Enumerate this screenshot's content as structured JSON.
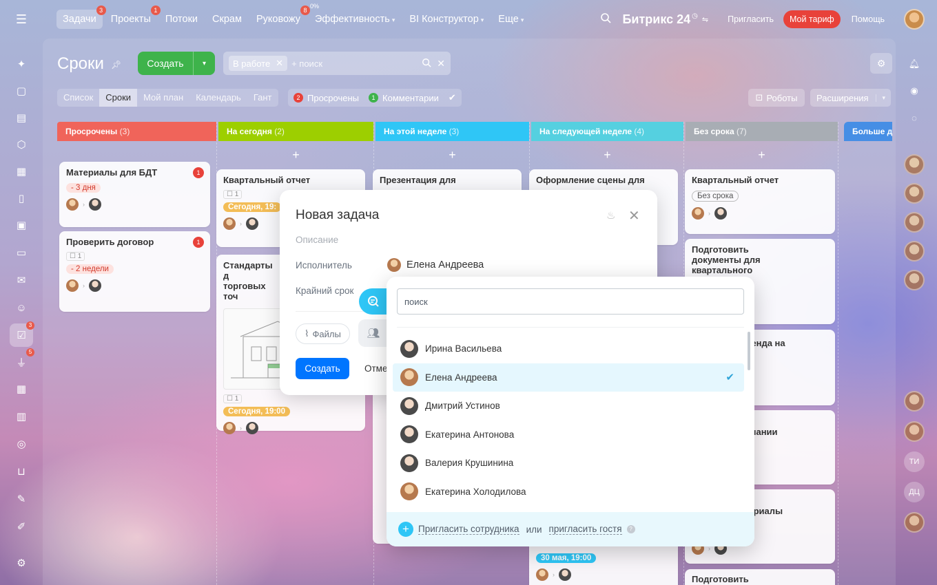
{
  "nav": {
    "items": [
      {
        "label": "Задачи",
        "badge": "3",
        "active": true
      },
      {
        "label": "Проекты",
        "badge": "1"
      },
      {
        "label": "Потоки"
      },
      {
        "label": "Скрам"
      },
      {
        "label": "Руковожу",
        "badge": "8"
      },
      {
        "label": "Эффективность",
        "pct": "0%",
        "dropdown": true
      },
      {
        "label": "BI Конструктор",
        "dropdown": true
      },
      {
        "label": "Еще",
        "dropdown": true
      }
    ],
    "logo": "Битрикс 24",
    "invite": "Пригласить",
    "tariff": "Мой тариф",
    "help": "Помощь"
  },
  "sidebar": {
    "task_badge": "3",
    "feed_badge": "5"
  },
  "toolbar": {
    "title": "Сроки",
    "create_label": "Создать",
    "filter_chip": "В работе",
    "search_placeholder": "+ поиск"
  },
  "views": [
    "Список",
    "Сроки",
    "Мой план",
    "Календарь",
    "Гант"
  ],
  "counters": {
    "overdue_count": "2",
    "overdue_label": "Просрочены",
    "comments_count": "1",
    "comments_label": "Комментарии"
  },
  "robots_label": "Роботы",
  "extensions_label": "Расширения",
  "columns": [
    {
      "title": "Просрочены",
      "count": "(3)",
      "color": "#f0645a"
    },
    {
      "title": "На сегодня",
      "count": "(2)",
      "color": "#9dcf00"
    },
    {
      "title": "На этой неделе",
      "count": "(3)",
      "color": "#2fc6f6"
    },
    {
      "title": "На следующей неделе",
      "count": "(4)",
      "color": "#55d0e0"
    },
    {
      "title": "Без срока",
      "count": "(7)",
      "color": "#a8adb4"
    },
    {
      "title": "Больше д",
      "count": "",
      "color": "#468ee5"
    }
  ],
  "cards": {
    "c1": {
      "title": "Материалы для БДТ",
      "badge": "1",
      "tag": "- 3 дня"
    },
    "c2": {
      "title": "Проверить договор",
      "badge": "1",
      "check": "1",
      "tag": "- 2 недели"
    },
    "c3": {
      "title": "Квартальный отчет",
      "check": "1",
      "tag": "Сегодня, 19:"
    },
    "c4": {
      "title": "Стандарты д торговых точ",
      "check": "1",
      "tag": "Сегодня, 19:00"
    },
    "c5": {
      "title": "Презентация для"
    },
    "c6": {
      "title": "Оформление сцены для"
    },
    "c7": {
      "title": "Квартальный отчет",
      "tag": "Без срока"
    },
    "c8": {
      "title": "Подготовить документы для квартального отчета"
    },
    "c9": {
      "title": "тенда на"
    },
    "c10": {
      "title": "мпании"
    },
    "c11": {
      "title": "териалы"
    },
    "c12": {
      "title": "Подготовить"
    },
    "c13": {
      "tag": "30 мая, 19:00"
    }
  },
  "modal": {
    "title": "Новая задача",
    "description_placeholder": "Описание",
    "assignee_label": "Исполнитель",
    "assignee_name": "Елена Андреева",
    "deadline_label": "Крайний срок",
    "files_label": "Файлы",
    "create_label": "Создать",
    "cancel_label": "Отме"
  },
  "dropdown": {
    "search_placeholder": "поиск",
    "people": [
      {
        "name": "Ирина Васильева",
        "selected": false
      },
      {
        "name": "Елена Андреева",
        "selected": true
      },
      {
        "name": "Дмитрий Устинов",
        "selected": false
      },
      {
        "name": "Екатерина Антонова",
        "selected": false
      },
      {
        "name": "Валерия Крушинина",
        "selected": false
      },
      {
        "name": "Екатерина Холодилова",
        "selected": false
      }
    ],
    "invite_employee": "Пригласить сотрудника",
    "or": "или",
    "invite_guest": "пригласить гостя"
  },
  "right_sidebar": {
    "initials_1": "ТИ",
    "initials_2": "ДЦ"
  },
  "colors": {
    "accent": "#2fc6f6",
    "create_green": "#3eb34b",
    "primary_blue": "#0075ff",
    "badge_red": "#e8423a"
  },
  "icons": [
    "burger-icon",
    "search-icon",
    "gear-icon",
    "bell-icon",
    "pin-icon",
    "close-icon",
    "fire-icon",
    "attach-icon",
    "people-icon",
    "chat-icon",
    "check-icon",
    "plus-icon",
    "question-icon",
    "robot-icon",
    "chevron-down-icon"
  ]
}
